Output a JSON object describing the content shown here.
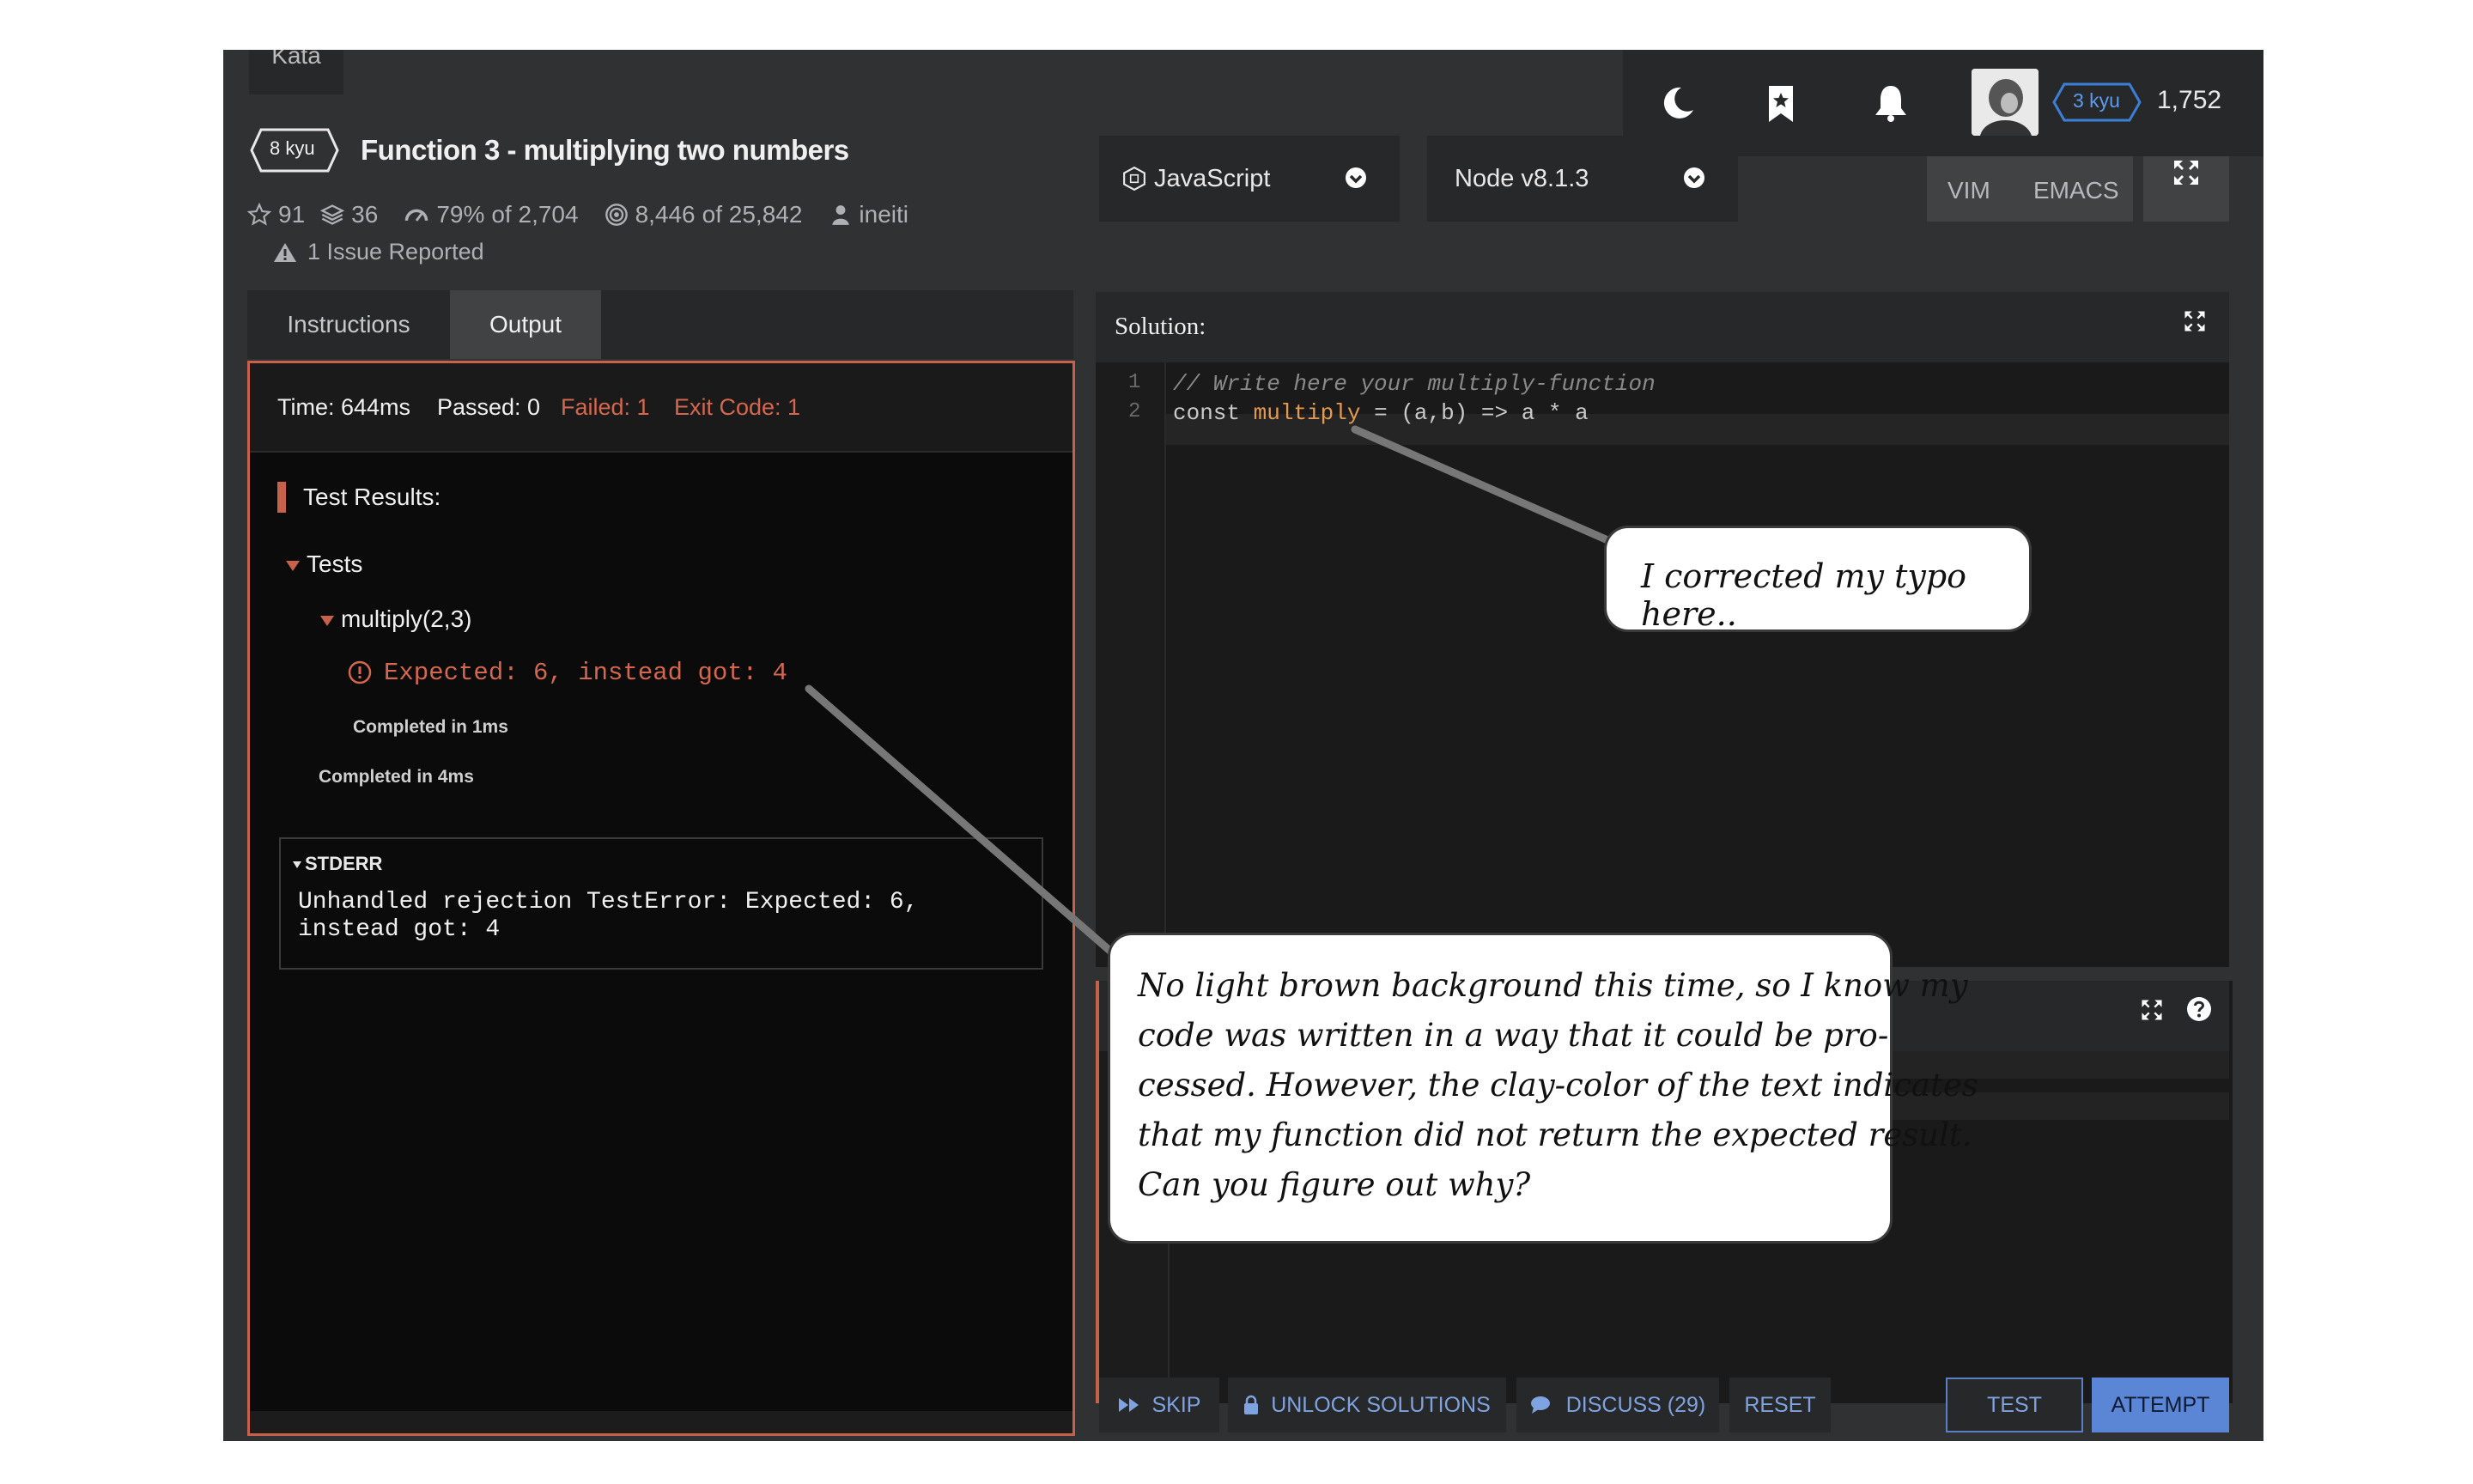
{
  "header": {
    "kata_tab": "Kata",
    "rank_badge": "8 kyu",
    "title": "Function 3 - multiplying two numbers",
    "stats": {
      "stars": "91",
      "collections": "36",
      "satisfaction": "79%",
      "satisfaction_of": "of 2,704",
      "completed": "8,446",
      "completed_of": "of 25,842",
      "author": "ineiti"
    },
    "issues": "1 Issue Reported"
  },
  "topbar": {
    "user_rank": "3 kyu",
    "honor": "1,752",
    "icons": [
      "moon-icon",
      "bookmark-icon",
      "bell-icon"
    ]
  },
  "editor_settings": {
    "language": "JavaScript",
    "version": "Node v8.1.3",
    "vim_label": "VIM",
    "emacs_label": "EMACS"
  },
  "left_panel": {
    "tabs": [
      {
        "label": "Instructions",
        "active": false
      },
      {
        "label": "Output",
        "active": true
      }
    ],
    "summary": {
      "time": "Time: 644ms",
      "passed": "Passed: 0",
      "failed": "Failed: 1",
      "exit_code": "Exit Code: 1"
    },
    "results_label": "Test Results:",
    "tree": {
      "group": "Tests",
      "case": "multiply(2,3)",
      "error": "Expected: 6, instead got: 4",
      "case_time": "Completed in 1ms",
      "group_time": "Completed in 4ms"
    },
    "stderr": {
      "label": "STDERR",
      "text": "Unhandled rejection TestError: Expected: 6,\ninstead got: 4"
    }
  },
  "solution": {
    "title": "Solution:",
    "line_numbers": [
      "1",
      "2"
    ],
    "line1": "// Write here your multiply-function",
    "line2": {
      "kw": "const",
      "name": "multiply",
      "rest": "= (a,b) => a * a"
    }
  },
  "buttons": {
    "skip": "SKIP",
    "unlock": "UNLOCK SOLUTIONS",
    "discuss": "DISCUSS (29)",
    "reset": "RESET",
    "test": "TEST",
    "attempt": "ATTEMPT"
  },
  "annotations": {
    "typo_note": "I corrected my typo here..",
    "explain_note": [
      "No light brown background this time, so I know my",
      "code was written in a way that it could be pro-",
      "cessed. However, the clay-color of the text indicates",
      "that my function did not return the expected result.",
      "Can you figure out why?"
    ]
  },
  "colors": {
    "accent_error": "#c8614a",
    "button_blue": "#5b86d6",
    "background": "#303133"
  }
}
